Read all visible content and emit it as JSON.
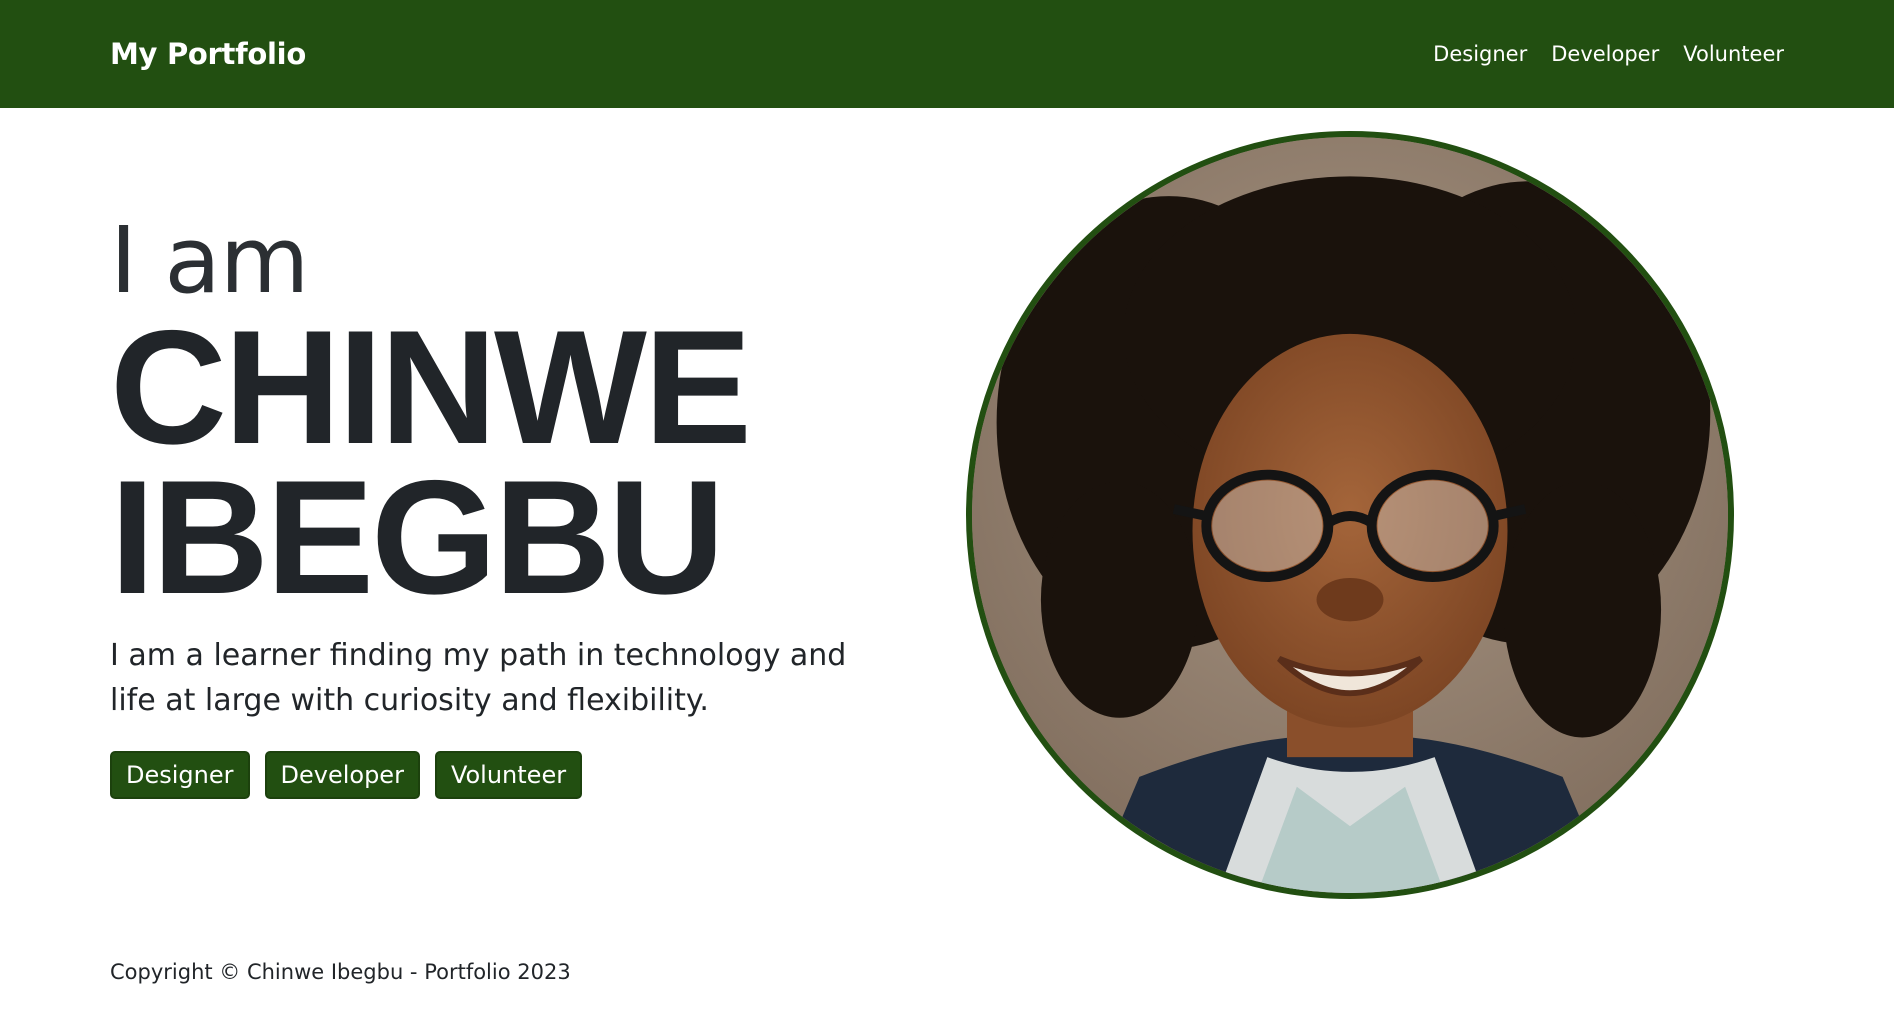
{
  "navbar": {
    "brand": "My Portfolio",
    "links": [
      "Designer",
      "Developer",
      "Volunteer"
    ],
    "background": "#224f11"
  },
  "hero": {
    "intro": "I am",
    "first_name": "CHINWE",
    "last_name": "IBEGBU",
    "tagline": "I am a learner finding my path in technology and life at large with curiosity and flexibility.",
    "buttons": [
      "Designer",
      "Developer",
      "Volunteer"
    ],
    "accent_color": "#224f11"
  },
  "portrait": {
    "alt": "portrait-photo",
    "border_color": "#224f11"
  },
  "footer": {
    "copyright": "Copyright © Chinwe Ibegbu - Portfolio 2023"
  }
}
